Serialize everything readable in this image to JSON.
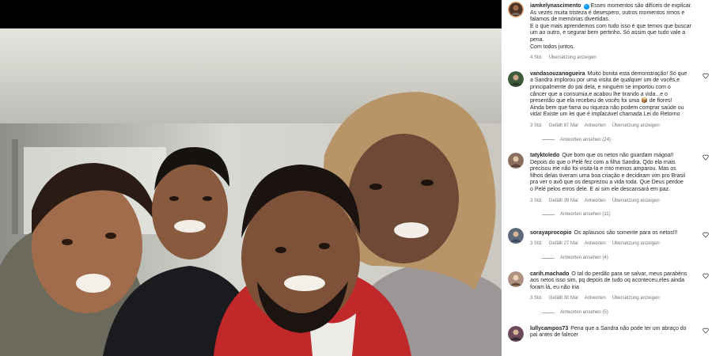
{
  "post": {
    "author": "iamkelynascimento",
    "caption": "Esses momentos são difíceis de explicar. As vezes muita tristeza é desespero, outros momentos rimos e falamos de memórias divertidas. E o que mais aprendemos com tudo isso é que temos que buscar um ao outro, e segurar bem pertinho. Só assim que tudo vale a pena. Com todos juntos.",
    "caption_lines": [
      "Esses momentos são difíceis de explicar.",
      "As vezes muita tristeza é desespero, outros momentos rimos e",
      "falamos de memórias divertidas.",
      "E o que mais aprendemos com tudo isso é que temos que buscar",
      "um ao outro, e segurar bem pertinho. Só assim que tudo vale a",
      "pena.",
      "Com todos juntos."
    ],
    "time": "4 Std.",
    "translate": "Übersetzung anzeigen"
  },
  "comments": [
    {
      "username": "vandasouzanogueira",
      "lines": [
        "Muito bonita esta demonstração! Só que",
        "a Sandra implorou por uma visita de qualquer um de vocês,e",
        "principalmente do pai dela, e ninguém se importou com o",
        "câncer que a consumia,e acabou lhe tirando a vida...e o",
        "presentão que ela recebeu de vocês foi uma 📦 de flores!",
        "Ainda bem que fama ou riqueza não podem comprar saúde ou",
        "vida! Existe um lei que é implacável chamada Lei do Retorno"
      ],
      "time": "3 Std.",
      "likes": "Gefällt 87 Mal",
      "reply": "Antworten",
      "translate": "Übersetzung anzeigen",
      "replies": "Antworten ansehen (24)",
      "avatar_color": "#3d5a3a"
    },
    {
      "username": "tatyktoledo",
      "lines": [
        "Que bom que os netos não guardam mágoa!!",
        "Depois do que o Pelé fez com a filha Sandra. Qdo ela mais",
        "precisou ele não foi visita-la e mto menos amparou. Mas os",
        "filhos delas tiveram uma boa criação e decidiram vim pro Brasil",
        "pra ver o avô que os desprezou a vida toda. Que Deus perdoe",
        "o Pelé pelos erros dele. E aí sim ele descansará em paz."
      ],
      "time": "3 Std.",
      "likes": "Gefällt 39 Mal",
      "reply": "Antworten",
      "translate": "Übersetzung anzeigen",
      "replies": "Antworten ansehen (11)",
      "avatar_color": "#8a6f60"
    },
    {
      "username": "sorayaprocopio",
      "lines": [
        "Os aplausos são somente para os netos!!!"
      ],
      "time": "3 Std.",
      "likes": "Gefällt 27 Mal",
      "reply": "Antworten",
      "translate": "Übersetzung anzeigen",
      "replies": "Antworten ansehen (4)",
      "avatar_color": "#5a6a7a"
    },
    {
      "username": "carih.machado",
      "lines": [
        "O tal do perdão para se salvar, meus parabéns",
        "aos netos isso sim, pq depois de tudo oq aconteceu,eles ainda",
        "foram lá, eu não iria"
      ],
      "time": "3 Std.",
      "likes": "Gefällt 30 Mal",
      "reply": "Antworten",
      "translate": "Übersetzung anzeigen",
      "replies": "Antworten ansehen (5)",
      "avatar_color": "#b09080"
    },
    {
      "username": "lullycampos73",
      "lines": [
        "Pena que a Sandra não pode ter um abraço do",
        "pai antes de falecer"
      ],
      "avatar_color": "#6a4a5a"
    }
  ],
  "colors": {
    "meta": "#737373",
    "text": "#262626",
    "verified": "#0095f6",
    "shirt_red": "#c0282a"
  }
}
